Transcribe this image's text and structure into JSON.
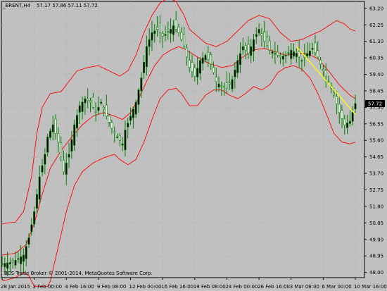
{
  "window": {
    "symbol": "_BRENT,H4",
    "ohlc": "57.17 57.86 57.11 57.72",
    "copyright": "BCS Trade Broker © 2001-2014, MetaQuotes Software Corp."
  },
  "colors": {
    "background": "#c0c0c0",
    "grid": "#a8a8a8",
    "candle": "#008000",
    "bands": "#ff0000",
    "trendline": "#ffff00",
    "price_marker": "#000000"
  },
  "chart_data": {
    "type": "candlestick",
    "symbol": "_BRENT",
    "timeframe": "H4",
    "last_price": "57.72",
    "ylim": [
      47.7,
      63.6
    ],
    "y_ticks": [
      "63.20",
      "62.25",
      "61.30",
      "60.35",
      "59.40",
      "58.45",
      "57.50",
      "56.55",
      "55.60",
      "54.65",
      "53.70",
      "52.75",
      "51.80",
      "50.85",
      "49.90",
      "48.95",
      "48.00"
    ],
    "x_ticks": [
      "28 Jan 2015",
      "2 Feb 00:00",
      "4 Feb 16:00",
      "9 Feb 08:00",
      "12 Feb 00:00",
      "16 Feb 16:00",
      "19 Feb 08:00",
      "24 Feb 00:00",
      "26 Feb 16:00",
      "3 Mar 08:00",
      "6 Mar 00:00",
      "10 Mar 16:00"
    ],
    "close_path": [
      [
        0,
        48.5
      ],
      [
        4,
        48.6
      ],
      [
        8,
        49.0
      ],
      [
        10,
        50.0
      ],
      [
        12,
        51.5
      ],
      [
        14,
        53.5
      ],
      [
        16,
        54.8
      ],
      [
        17,
        55.8
      ],
      [
        19,
        56.5
      ],
      [
        21,
        55.5
      ],
      [
        23,
        53.8
      ],
      [
        25,
        54.8
      ],
      [
        27,
        56.5
      ],
      [
        29,
        57.6
      ],
      [
        31,
        58.0
      ],
      [
        33,
        57.8
      ],
      [
        35,
        57.2
      ],
      [
        37,
        57.8
      ],
      [
        39,
        57.0
      ],
      [
        41,
        56.3
      ],
      [
        43,
        55.8
      ],
      [
        45,
        55.4
      ],
      [
        46,
        56.2
      ],
      [
        48,
        57.0
      ],
      [
        50,
        57.8
      ],
      [
        52,
        59.2
      ],
      [
        54,
        61.0
      ],
      [
        56,
        61.8
      ],
      [
        58,
        62.0
      ],
      [
        60,
        61.6
      ],
      [
        62,
        61.8
      ],
      [
        64,
        62.2
      ],
      [
        66,
        61.8
      ],
      [
        68,
        61.0
      ],
      [
        70,
        59.8
      ],
      [
        72,
        59.3
      ],
      [
        74,
        60.2
      ],
      [
        76,
        60.5
      ],
      [
        78,
        60.0
      ],
      [
        80,
        59.0
      ],
      [
        82,
        58.7
      ],
      [
        84,
        58.6
      ],
      [
        86,
        59.1
      ],
      [
        88,
        60.2
      ],
      [
        90,
        61.0
      ],
      [
        92,
        60.6
      ],
      [
        94,
        61.4
      ],
      [
        96,
        62.0
      ],
      [
        98,
        61.3
      ],
      [
        100,
        60.8
      ],
      [
        102,
        60.6
      ],
      [
        104,
        60.4
      ],
      [
        106,
        60.5
      ],
      [
        108,
        60.8
      ],
      [
        110,
        60.6
      ],
      [
        112,
        60.2
      ],
      [
        114,
        60.6
      ],
      [
        116,
        60.9
      ],
      [
        118,
        60.4
      ],
      [
        120,
        59.6
      ],
      [
        122,
        59.0
      ],
      [
        124,
        58.2
      ],
      [
        126,
        57.2
      ],
      [
        128,
        56.5
      ],
      [
        130,
        56.7
      ],
      [
        132,
        57.72
      ]
    ],
    "bands_upper": [
      [
        0,
        50.8
      ],
      [
        5,
        50.9
      ],
      [
        8,
        51.5
      ],
      [
        11,
        53.5
      ],
      [
        13,
        56.0
      ],
      [
        15,
        57.5
      ],
      [
        18,
        58.3
      ],
      [
        22,
        58.4
      ],
      [
        25,
        59.0
      ],
      [
        28,
        59.6
      ],
      [
        32,
        59.8
      ],
      [
        36,
        59.9
      ],
      [
        40,
        59.6
      ],
      [
        44,
        59.3
      ],
      [
        47,
        59.6
      ],
      [
        50,
        60.5
      ],
      [
        53,
        61.8
      ],
      [
        56,
        62.8
      ],
      [
        59,
        63.5
      ],
      [
        62,
        63.8
      ],
      [
        65,
        63.6
      ],
      [
        68,
        62.8
      ],
      [
        70,
        62.0
      ],
      [
        73,
        61.6
      ],
      [
        76,
        61.2
      ],
      [
        80,
        61.0
      ],
      [
        84,
        61.3
      ],
      [
        88,
        61.9
      ],
      [
        92,
        62.5
      ],
      [
        96,
        62.8
      ],
      [
        100,
        62.6
      ],
      [
        104,
        61.8
      ],
      [
        108,
        61.3
      ],
      [
        112,
        61.4
      ],
      [
        116,
        61.7
      ],
      [
        119,
        61.9
      ],
      [
        122,
        62.2
      ],
      [
        125,
        62.5
      ],
      [
        128,
        62.3
      ],
      [
        130,
        62.0
      ],
      [
        132,
        61.9
      ]
    ],
    "bands_middle": [
      [
        0,
        49.0
      ],
      [
        5,
        49.1
      ],
      [
        9,
        49.6
      ],
      [
        12,
        50.8
      ],
      [
        15,
        52.5
      ],
      [
        18,
        54.0
      ],
      [
        22,
        55.0
      ],
      [
        26,
        55.8
      ],
      [
        30,
        56.5
      ],
      [
        34,
        57.0
      ],
      [
        38,
        57.2
      ],
      [
        42,
        57.0
      ],
      [
        45,
        56.8
      ],
      [
        48,
        57.2
      ],
      [
        51,
        58.0
      ],
      [
        54,
        59.0
      ],
      [
        57,
        59.9
      ],
      [
        60,
        60.5
      ],
      [
        63,
        60.8
      ],
      [
        66,
        61.0
      ],
      [
        69,
        60.8
      ],
      [
        72,
        60.5
      ],
      [
        75,
        60.2
      ],
      [
        78,
        60.0
      ],
      [
        82,
        59.8
      ],
      [
        86,
        59.9
      ],
      [
        90,
        60.4
      ],
      [
        94,
        60.8
      ],
      [
        98,
        60.9
      ],
      [
        102,
        60.7
      ],
      [
        106,
        60.5
      ],
      [
        110,
        60.6
      ],
      [
        114,
        60.6
      ],
      [
        118,
        60.3
      ],
      [
        122,
        59.6
      ],
      [
        126,
        58.8
      ],
      [
        130,
        58.2
      ],
      [
        132,
        58.0
      ]
    ],
    "bands_lower": [
      [
        0,
        47.5
      ],
      [
        5,
        47.7
      ],
      [
        8,
        48.0
      ],
      [
        10,
        47.8
      ],
      [
        12,
        47.2
      ],
      [
        15,
        46.5
      ],
      [
        18,
        47.5
      ],
      [
        21,
        49.5
      ],
      [
        24,
        51.5
      ],
      [
        27,
        53.0
      ],
      [
        30,
        53.8
      ],
      [
        34,
        54.3
      ],
      [
        38,
        54.6
      ],
      [
        42,
        54.8
      ],
      [
        44,
        54.5
      ],
      [
        47,
        54.2
      ],
      [
        50,
        54.5
      ],
      [
        53,
        55.5
      ],
      [
        56,
        56.8
      ],
      [
        59,
        58.0
      ],
      [
        62,
        58.5
      ],
      [
        65,
        58.6
      ],
      [
        67,
        58.3
      ],
      [
        70,
        57.6
      ],
      [
        73,
        57.6
      ],
      [
        76,
        58.2
      ],
      [
        79,
        58.5
      ],
      [
        82,
        58.5
      ],
      [
        85,
        58.2
      ],
      [
        88,
        58.0
      ],
      [
        91,
        58.3
      ],
      [
        94,
        58.7
      ],
      [
        97,
        58.5
      ],
      [
        100,
        58.8
      ],
      [
        103,
        59.5
      ],
      [
        106,
        59.8
      ],
      [
        109,
        59.9
      ],
      [
        112,
        59.7
      ],
      [
        115,
        59.2
      ],
      [
        118,
        58.3
      ],
      [
        121,
        57.2
      ],
      [
        124,
        56.0
      ],
      [
        127,
        55.5
      ],
      [
        130,
        55.4
      ],
      [
        132,
        55.5
      ]
    ],
    "trendline": [
      [
        110,
        61.0
      ],
      [
        132,
        57.1
      ]
    ]
  }
}
